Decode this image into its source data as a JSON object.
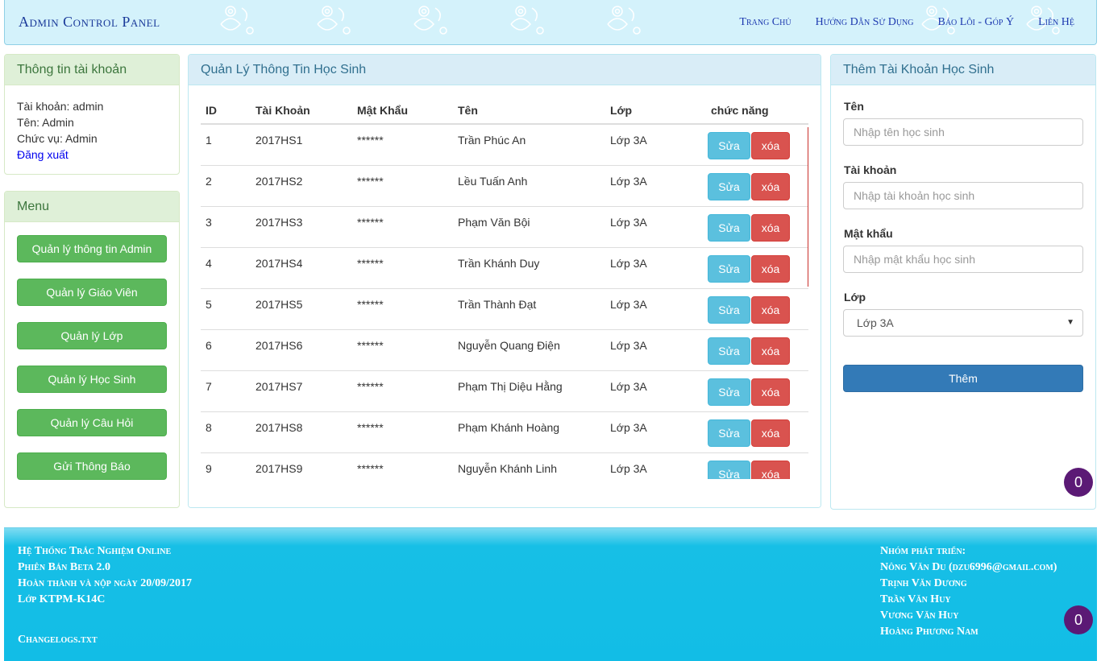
{
  "brand": "Admin Control Panel",
  "nav": [
    "Trang Chủ",
    "Hướng Dẫn Sử Dụng",
    "Báo Lỗi - Góp Ý",
    "Liên Hệ"
  ],
  "account": {
    "title": "Thông tin tài khoản",
    "username_line": "Tài khoản: admin",
    "name_line": "Tên: Admin",
    "role_line": "Chức vụ: Admin",
    "logout": "Đăng xuất"
  },
  "menu": {
    "title": "Menu",
    "items": [
      "Quản lý thông tin Admin",
      "Quản lý Giáo Viên",
      "Quản lý Lớp",
      "Quản lý Học Sinh",
      "Quản lý Câu Hỏi",
      "Gửi Thông Báo"
    ]
  },
  "students": {
    "title": "Quản Lý Thông Tin Học Sinh",
    "columns": [
      "ID",
      "Tài Khoản",
      "Mật Khẩu",
      "Tên",
      "Lớp",
      "chức năng"
    ],
    "edit_label": "Sửa",
    "delete_label": "xóa",
    "rows": [
      {
        "id": "1",
        "account": "2017HS1",
        "password": "******",
        "name": "Trần Phúc An",
        "class": "Lớp 3A"
      },
      {
        "id": "2",
        "account": "2017HS2",
        "password": "******",
        "name": "Lều Tuấn Anh",
        "class": "Lớp 3A"
      },
      {
        "id": "3",
        "account": "2017HS3",
        "password": "******",
        "name": "Phạm Văn Bội",
        "class": "Lớp 3A"
      },
      {
        "id": "4",
        "account": "2017HS4",
        "password": "******",
        "name": "Trần Khánh Duy",
        "class": "Lớp 3A"
      },
      {
        "id": "5",
        "account": "2017HS5",
        "password": "******",
        "name": "Trần Thành Đạt",
        "class": "Lớp 3A"
      },
      {
        "id": "6",
        "account": "2017HS6",
        "password": "******",
        "name": "Nguyễn Quang Điện",
        "class": "Lớp 3A"
      },
      {
        "id": "7",
        "account": "2017HS7",
        "password": "******",
        "name": "Phạm Thị Diệu Hằng",
        "class": "Lớp 3A"
      },
      {
        "id": "8",
        "account": "2017HS8",
        "password": "******",
        "name": "Phạm Khánh Hoàng",
        "class": "Lớp 3A"
      },
      {
        "id": "9",
        "account": "2017HS9",
        "password": "******",
        "name": "Nguyễn Khánh Linh",
        "class": "Lớp 3A"
      }
    ]
  },
  "add_form": {
    "title": "Thêm Tài Khoản Học Sinh",
    "name_label": "Tên",
    "name_placeholder": "Nhập tên học sinh",
    "account_label": "Tài khoản",
    "account_placeholder": "Nhập tài khoản học sinh",
    "password_label": "Mật khẩu",
    "password_placeholder": "Nhập mật khẩu học sinh",
    "class_label": "Lớp",
    "class_selected": "Lớp 3A",
    "submit": "Thêm"
  },
  "badges": {
    "top": "0",
    "bottom": "0"
  },
  "footer": {
    "left": [
      "Hệ Thống Trắc Nghiệm Online",
      "Phiên Bản Beta 2.0",
      "Hoàn thành và nộp ngày 20/09/2017",
      "Lớp KTPM-K14C"
    ],
    "changelog": "Changelogs.txt",
    "right_title": "Nhóm phát triển:",
    "right": [
      "Nông Văn Du (dzu6996@gmail.com)",
      "Trịnh Văn Dương",
      "Trần Văn Huy",
      "Vương Văn Huy",
      "Hoàng Phương Nam"
    ]
  },
  "colors": {
    "success": "#5cb85c",
    "info": "#5bc0de",
    "danger": "#d9534f",
    "primary": "#337ab7",
    "footer": "#12bde6",
    "badge": "#5b1a75"
  }
}
